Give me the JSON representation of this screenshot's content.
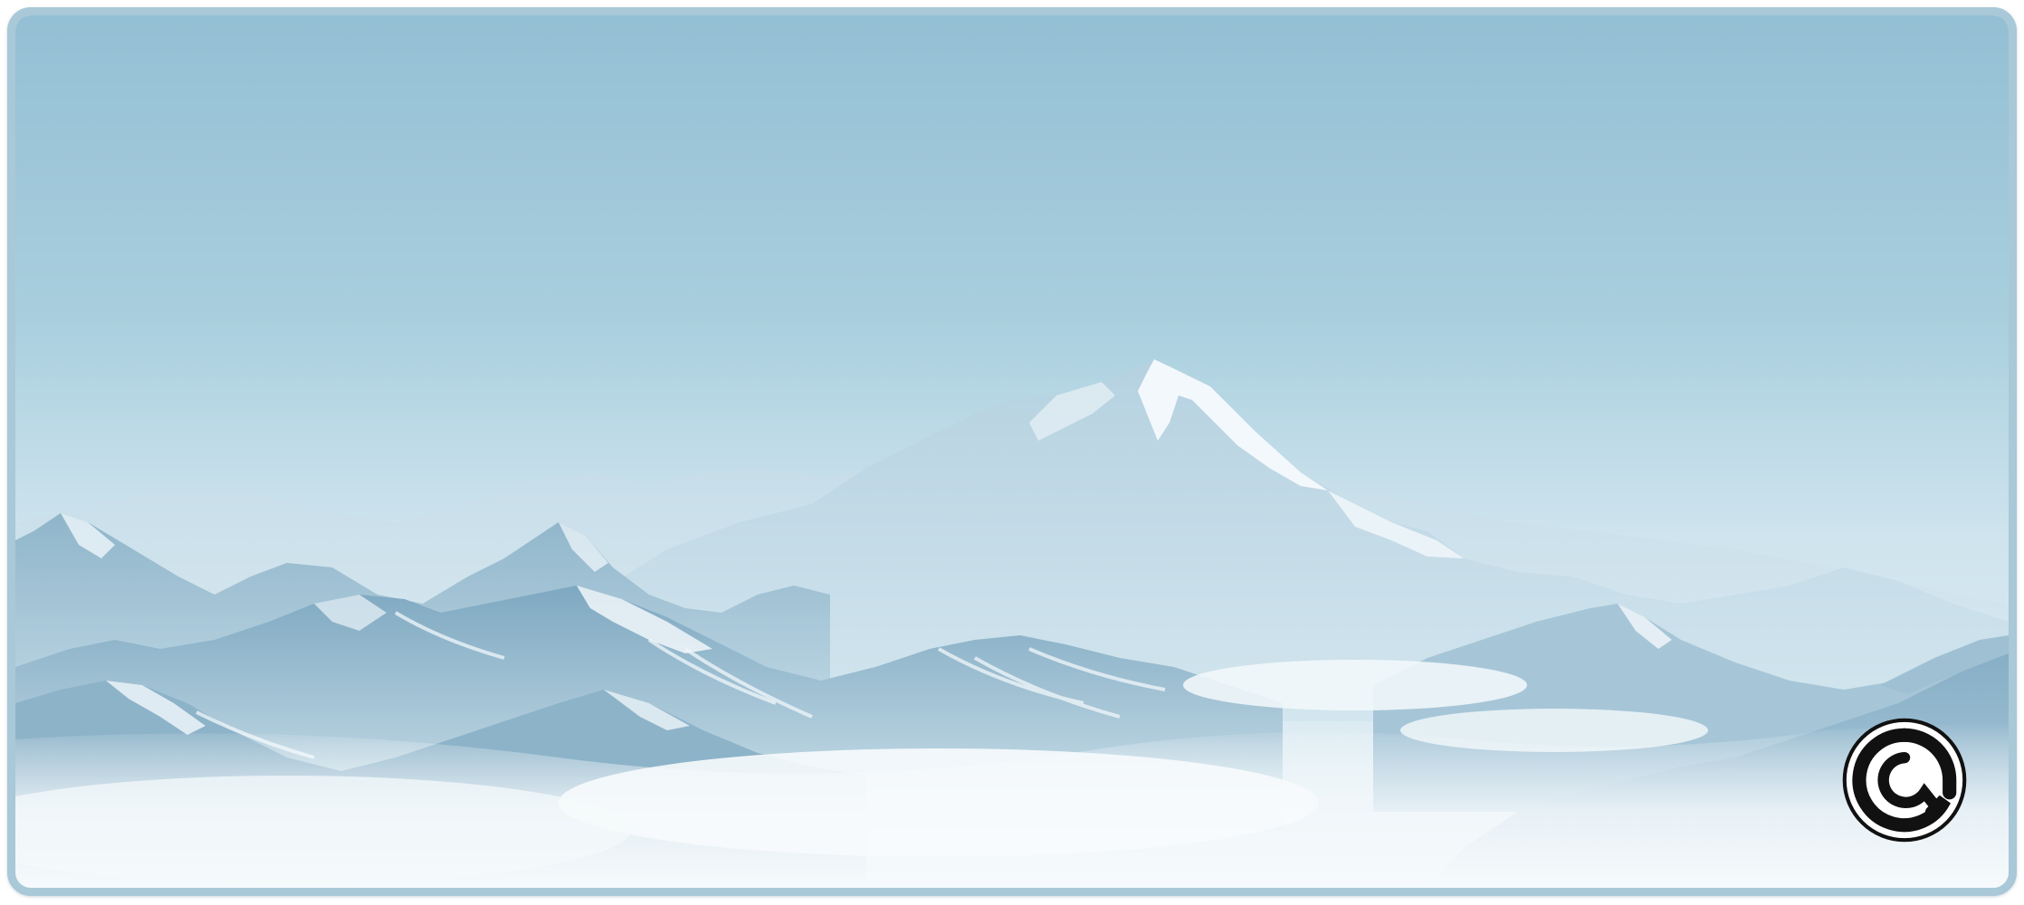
{
  "product": {
    "type": "desk-mat",
    "theme": "snowy-mountain-range"
  },
  "colors": {
    "sky_top": "#94bfd4",
    "sky_bottom": "#dcebf2",
    "far_ridge": "#b7d3e1",
    "mid_ridge": "#a3c4d6",
    "near_ridge": "#7fa9c2",
    "snow": "#f4f9fc",
    "mist": "#f2f7fa",
    "stitched_edge": "#a9c8d8"
  },
  "logo": {
    "icon": "brand-logo-icon",
    "fill": "#111111",
    "background": "#ffffff"
  }
}
